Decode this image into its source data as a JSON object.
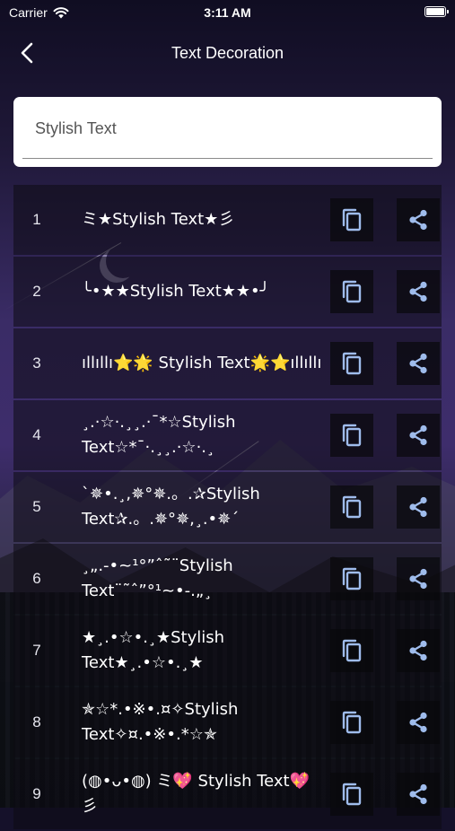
{
  "status_bar": {
    "carrier": "Carrier",
    "time": "3:11 AM",
    "wifi_icon": "wifi-icon",
    "battery_icon": "battery-icon"
  },
  "nav": {
    "title": "Text Decoration",
    "back_icon": "chevron-left-icon"
  },
  "input": {
    "placeholder": "Stylish Text",
    "value": ""
  },
  "colors": {
    "icon_color": "#9fbcec",
    "row_background": "#0c0b12",
    "text": "#ffffff"
  },
  "items": [
    {
      "number": "1",
      "text": "ミ★Stylish Text★彡"
    },
    {
      "number": "2",
      "text": "╰•★★Stylish Text★★•╯"
    },
    {
      "number": "3",
      "text": "ıllıllı⭐🌟 Stylish Text🌟⭐ıllıllı"
    },
    {
      "number": "4",
      "text": "¸.·☆·.¸¸.·¯*☆Stylish Text☆*¯·.¸¸.·☆·.¸"
    },
    {
      "number": "5",
      "text": "`✵•.¸,✵°✵.。.✰Stylish Text✰.。.✵°✵,¸.•✵´"
    },
    {
      "number": "6",
      "text": "¸„.-•~¹°”ˆ˜¨Stylish Text¨˜ˆ”°¹~•-.„¸"
    },
    {
      "number": "7",
      "text": "★¸.•☆•.¸★Stylish Text★¸.•☆•.¸★"
    },
    {
      "number": "8",
      "text": "✯☆*.•※•.¤✧Stylish Text✧¤.•※•.*☆✯"
    },
    {
      "number": "9",
      "text": "(◍•ᴗ•◍) ミ💖 Stylish Text💖彡"
    }
  ],
  "actions": {
    "copy_icon": "copy-icon",
    "share_icon": "share-icon"
  }
}
